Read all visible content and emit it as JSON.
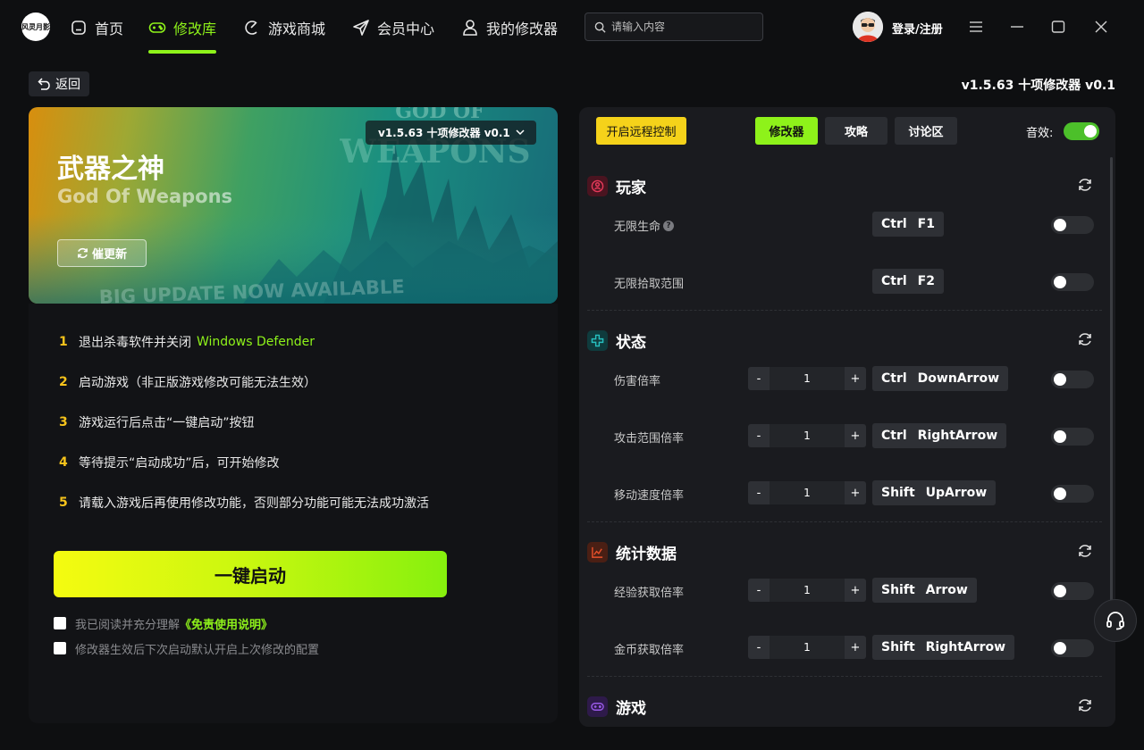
{
  "app": {
    "logo_text": "风灵月影"
  },
  "nav": {
    "items": [
      {
        "label": "首页"
      },
      {
        "label": "修改库"
      },
      {
        "label": "游戏商城"
      },
      {
        "label": "会员中心"
      },
      {
        "label": "我的修改器"
      }
    ],
    "active_index": 1,
    "active_color": "#8ef21a"
  },
  "search": {
    "placeholder": "请输入内容",
    "value": ""
  },
  "user": {
    "login_label": "登录/注册"
  },
  "toolbar": {
    "back_label": "返回",
    "version_label": "v1.5.63 十项修改器 v0.1"
  },
  "banner": {
    "title": "武器之神",
    "subtitle": "God Of Weapons",
    "update_label": "催更新",
    "version_select": "v1.5.63 十项修改器 v0.1",
    "bg_logo_line1": "GOD OF",
    "bg_logo_line2": "WEAPONS",
    "bg_caption": "BIG UPDATE NOW AVAILABLE"
  },
  "steps": [
    {
      "num": "1",
      "text": "退出杀毒软件并关闭",
      "highlight": "Windows Defender"
    },
    {
      "num": "2",
      "text": "启动游戏（非正版游戏修改可能无法生效）",
      "highlight": ""
    },
    {
      "num": "3",
      "text": "游戏运行后点击“一键启动”按钮",
      "highlight": ""
    },
    {
      "num": "4",
      "text": "等待提示“启动成功”后，可开始修改",
      "highlight": ""
    },
    {
      "num": "5",
      "text": "请载入游戏后再使用修改功能，否则部分功能可能无法成功激活",
      "highlight": ""
    }
  ],
  "start_button": {
    "label": "一键启动"
  },
  "agreement": {
    "prefix": "我已阅读并充分理解",
    "link": "《免责使用说明》",
    "remember": "修改器生效后下次启动默认开启上次修改的配置"
  },
  "right": {
    "remote_label": "开启远程控制",
    "tabs": [
      {
        "label": "修改器"
      },
      {
        "label": "攻略"
      },
      {
        "label": "讨论区"
      }
    ],
    "active_tab": 0,
    "sound_label": "音效:",
    "sound_on": true
  },
  "sections": [
    {
      "title": "玩家",
      "icon": "player-icon",
      "color": "#e63a5a",
      "options": [
        {
          "label": "无限生命",
          "help": "?",
          "keys": [
            "Ctrl",
            "F1"
          ],
          "on": false
        },
        {
          "label": "无限拾取范围",
          "keys": [
            "Ctrl",
            "F2"
          ],
          "on": false
        }
      ]
    },
    {
      "title": "状态",
      "icon": "status-icon",
      "color": "#27c0c0",
      "options": [
        {
          "label": "伤害倍率",
          "value": "1",
          "keys": [
            "Ctrl",
            "DownArrow"
          ],
          "on": false
        },
        {
          "label": "攻击范围倍率",
          "value": "1",
          "keys": [
            "Ctrl",
            "RightArrow"
          ],
          "on": false
        },
        {
          "label": "移动速度倍率",
          "value": "1",
          "keys": [
            "Shift",
            "UpArrow"
          ],
          "on": false
        }
      ]
    },
    {
      "title": "统计数据",
      "icon": "stats-chart-icon",
      "color": "#e8502a",
      "options": [
        {
          "label": "经验获取倍率",
          "value": "1",
          "keys": [
            "Shift",
            "Arrow"
          ],
          "on": false
        },
        {
          "label": "金币获取倍率",
          "value": "1",
          "keys": [
            "Shift",
            "RightArrow"
          ],
          "on": false
        }
      ]
    },
    {
      "title": "游戏",
      "icon": "gamepad-icon",
      "color": "#9a5ae8",
      "options": []
    }
  ],
  "stepper": {
    "minus": "-",
    "plus": "+"
  }
}
